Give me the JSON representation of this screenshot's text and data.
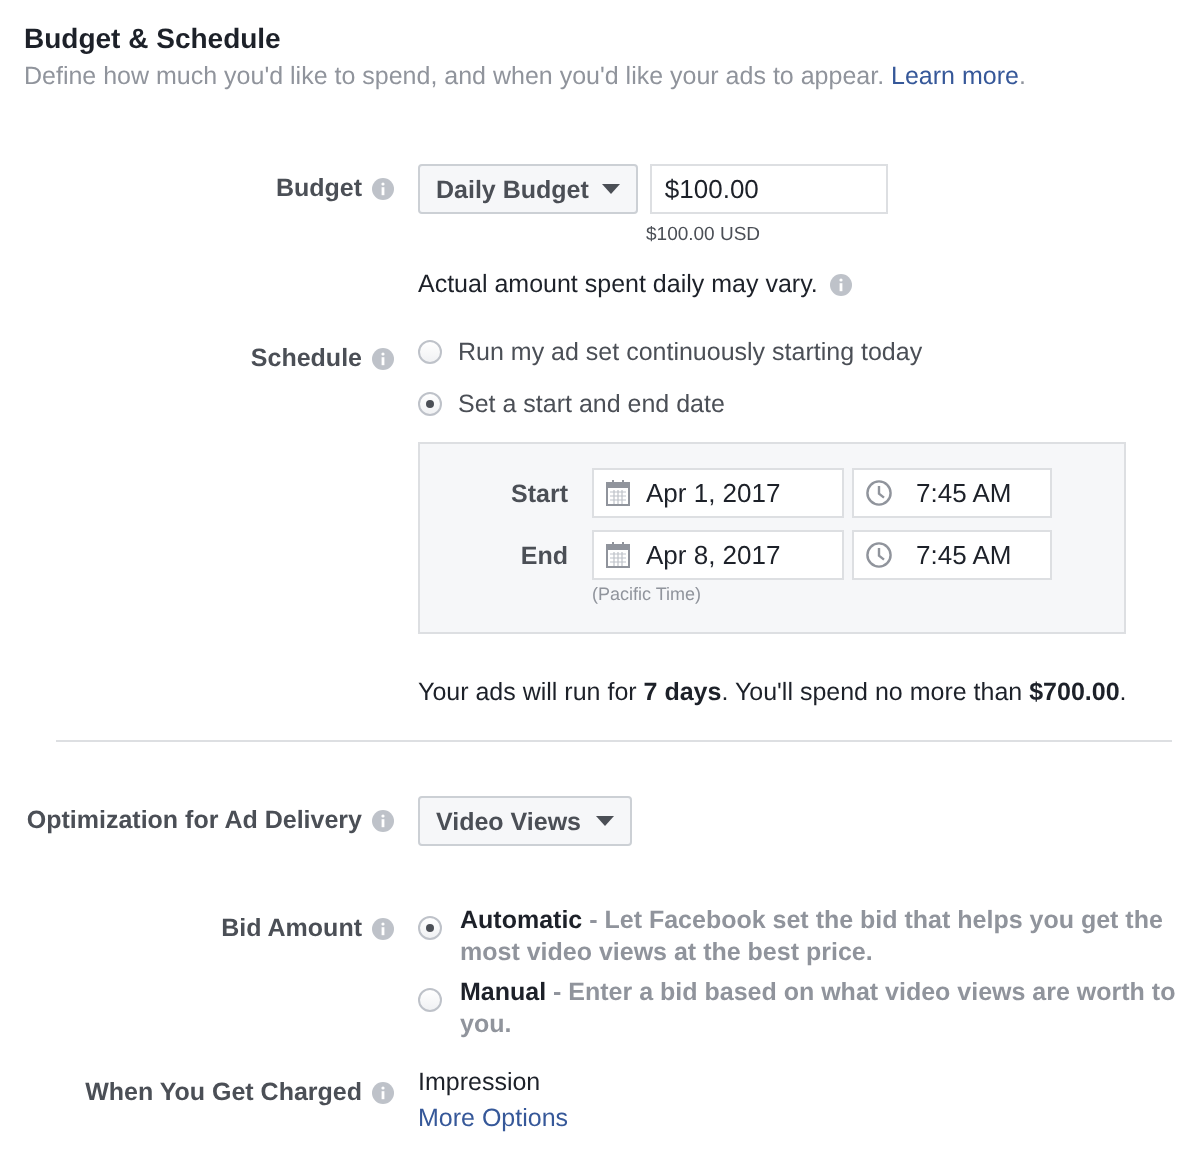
{
  "header": {
    "title": "Budget & Schedule",
    "subtitle": "Define how much you'd like to spend, and when you'd like your ads to appear.",
    "link": "Learn more",
    "after_link": "."
  },
  "budget": {
    "label": "Budget",
    "dropdown": "Daily Budget",
    "value": "$100.00",
    "hint": "$100.00 USD",
    "note": "Actual amount spent daily may vary."
  },
  "schedule": {
    "label": "Schedule",
    "options": [
      {
        "text": "Run my ad set continuously starting today",
        "selected": false
      },
      {
        "text": "Set a start and end date",
        "selected": true
      }
    ],
    "dates": [
      {
        "label": "Start",
        "date": "Apr 1, 2017",
        "time": "7:45 AM"
      },
      {
        "label": "End",
        "date": "Apr 8, 2017",
        "time": "7:45 AM"
      }
    ],
    "timezone": "(Pacific Time)",
    "summary": "Your ads will run for **7 days**. You'll spend no more than **$700.00**."
  },
  "optimization": {
    "label": "Optimization for Ad Delivery",
    "dropdown": "Video Views"
  },
  "bid": {
    "label": "Bid Amount",
    "options": [
      {
        "text": "**Automatic** - Let Facebook set the bid that helps you get the most video views at the best price.",
        "selected": true
      },
      {
        "text": "**Manual** - Enter a bid based on what video views are worth to you.",
        "selected": false
      }
    ]
  },
  "charged": {
    "label": "When You Get Charged",
    "value": "Impression",
    "link": "More Options"
  }
}
